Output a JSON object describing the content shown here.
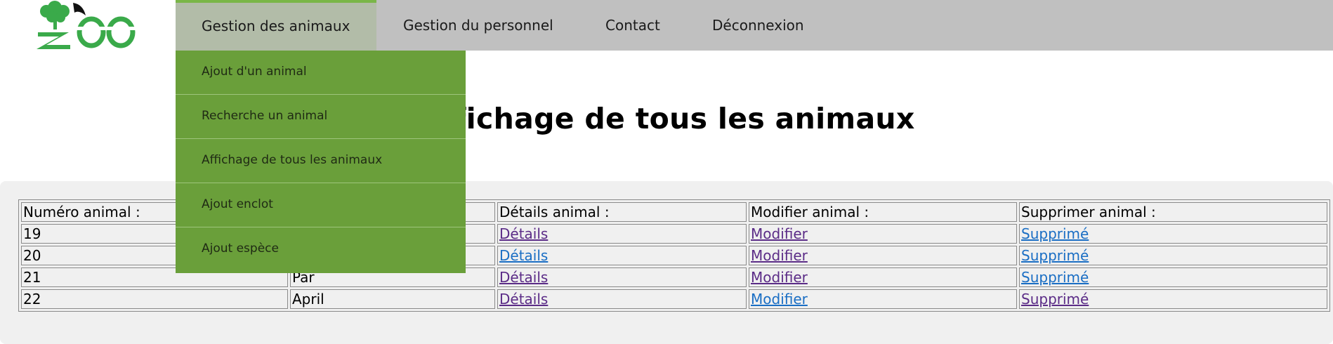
{
  "logo": {
    "text": "ZOO",
    "color": "#3aaa4a"
  },
  "nav": {
    "items": [
      {
        "label": "Gestion des animaux",
        "active": true
      },
      {
        "label": "Gestion du personnel"
      },
      {
        "label": "Contact"
      },
      {
        "label": "Déconnexion"
      }
    ]
  },
  "dropdown": {
    "items": [
      {
        "label": "Ajout d'un animal"
      },
      {
        "label": "Recherche un animal"
      },
      {
        "label": "Affichage de tous les animaux"
      },
      {
        "label": "Ajout enclot"
      },
      {
        "label": "Ajout espèce"
      }
    ]
  },
  "page_title": "Affichage de tous les animaux",
  "table": {
    "headers": [
      "Numéro animal :",
      "",
      "Détails animal :",
      "Modifier animal :",
      "Supprimer animal :"
    ],
    "rows": [
      {
        "num": "19",
        "name": "",
        "details": "Détails",
        "modify": "Modifier",
        "delete": "Supprimé"
      },
      {
        "num": "20",
        "name": "",
        "details": "Détails",
        "modify": "Modifier",
        "delete": "Supprimé"
      },
      {
        "num": "21",
        "name": "Par",
        "details": "Détails",
        "modify": "Modifier",
        "delete": "Supprimé"
      },
      {
        "num": "22",
        "name": "April",
        "details": "Détails",
        "modify": "Modifier",
        "delete": "Supprimé"
      }
    ]
  },
  "colors": {
    "nav_bg": "#c0c0c0",
    "nav_active": "#b2bca8",
    "dropdown_bg": "#6a9f3a",
    "link": "#1a6ec4",
    "link_visited": "#5b2c87"
  }
}
